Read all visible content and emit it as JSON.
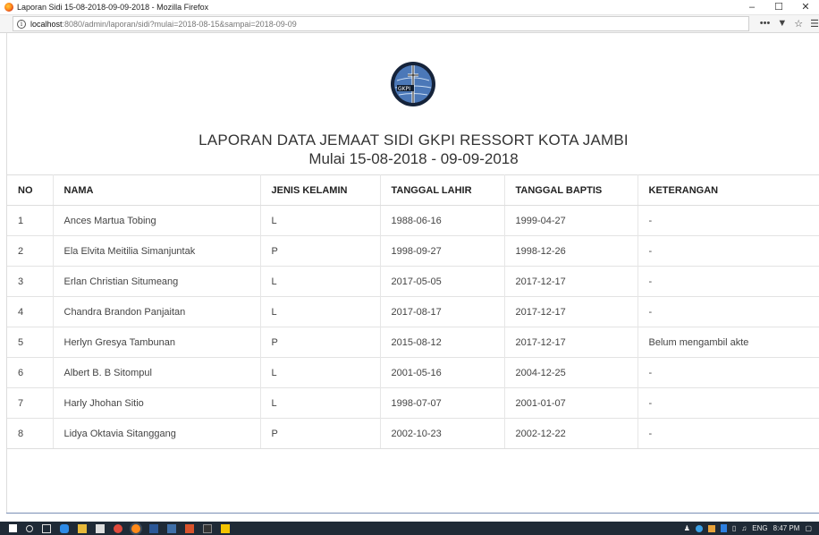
{
  "window": {
    "title": "Laporan Sidi 15-08-2018-09-09-2018 - Mozilla Firefox",
    "controls": [
      "–",
      "☐",
      "✕"
    ]
  },
  "navbar": {
    "url_host": "localhost",
    "url_rest": ":8080/admin/laporan/sidi?mulai=2018-08-15&sampai=2018-09-09",
    "icons": [
      "more-icon",
      "pocket-icon",
      "bookmark-star-icon",
      "menu-icon"
    ]
  },
  "report": {
    "logo_text": "GKPI",
    "title": "LAPORAN DATA JEMAAT SIDI GKPI RESSORT KOTA JAMBI",
    "subtitle": "Mulai 15-08-2018 - 09-09-2018"
  },
  "table": {
    "headers": [
      "NO",
      "NAMA",
      "JENIS KELAMIN",
      "TANGGAL LAHIR",
      "TANGGAL BAPTIS",
      "KETERANGAN"
    ],
    "rows": [
      [
        "1",
        "Ances Martua Tobing",
        "L",
        "1988-06-16",
        "1999-04-27",
        "-"
      ],
      [
        "2",
        "Ela Elvita Meitilia Simanjuntak",
        "P",
        "1998-09-27",
        "1998-12-26",
        "-"
      ],
      [
        "3",
        "Erlan Christian Situmeang",
        "L",
        "2017-05-05",
        "2017-12-17",
        "-"
      ],
      [
        "4",
        "Chandra Brandon Panjaitan",
        "L",
        "2017-08-17",
        "2017-12-17",
        "-"
      ],
      [
        "5",
        "Herlyn Gresya Tambunan",
        "P",
        "2015-08-12",
        "2017-12-17",
        "Belum mengambil akte"
      ],
      [
        "6",
        "Albert B. B Sitompul",
        "L",
        "2001-05-16",
        "2004-12-25",
        "-"
      ],
      [
        "7",
        "Harly Jhohan Sitio",
        "L",
        "1998-07-07",
        "2001-01-07",
        "-"
      ],
      [
        "8",
        "Lidya Oktavia Sitanggang",
        "P",
        "2002-10-23",
        "2002-12-22",
        "-"
      ]
    ]
  },
  "taskbar": {
    "lang": "ENG",
    "time": "8:47 PM"
  }
}
